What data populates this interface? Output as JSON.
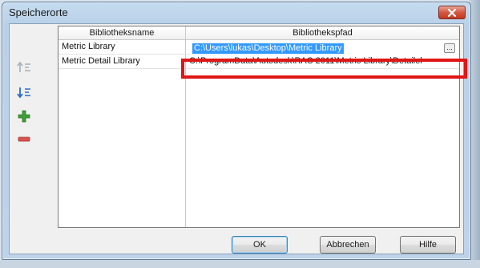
{
  "window": {
    "title": "Speicherorte"
  },
  "table": {
    "columns": [
      "Bibliotheksname",
      "Bibliothekspfad"
    ],
    "rows": [
      {
        "name": "Metric Library",
        "path": "C:\\Users\\lukas\\Desktop\\Metric Library"
      },
      {
        "name": "Metric Detail Library",
        "path": "C:\\ProgramData\\Autodesk\\RAC 2011\\Metric Library\\Detailel"
      }
    ],
    "edit_button": "..."
  },
  "side_toolbar": {
    "icons": [
      "move-up-icon",
      "move-down-icon",
      "add-icon",
      "remove-icon"
    ]
  },
  "buttons": {
    "ok": "OK",
    "cancel": "Abbrechen",
    "help": "Hilfe"
  },
  "colors": {
    "selection": "#3399ff",
    "highlight": "#e01616",
    "add_icon": "#3fa03a",
    "remove_icon": "#d9534f",
    "move_down_icon": "#2b6cc4"
  }
}
